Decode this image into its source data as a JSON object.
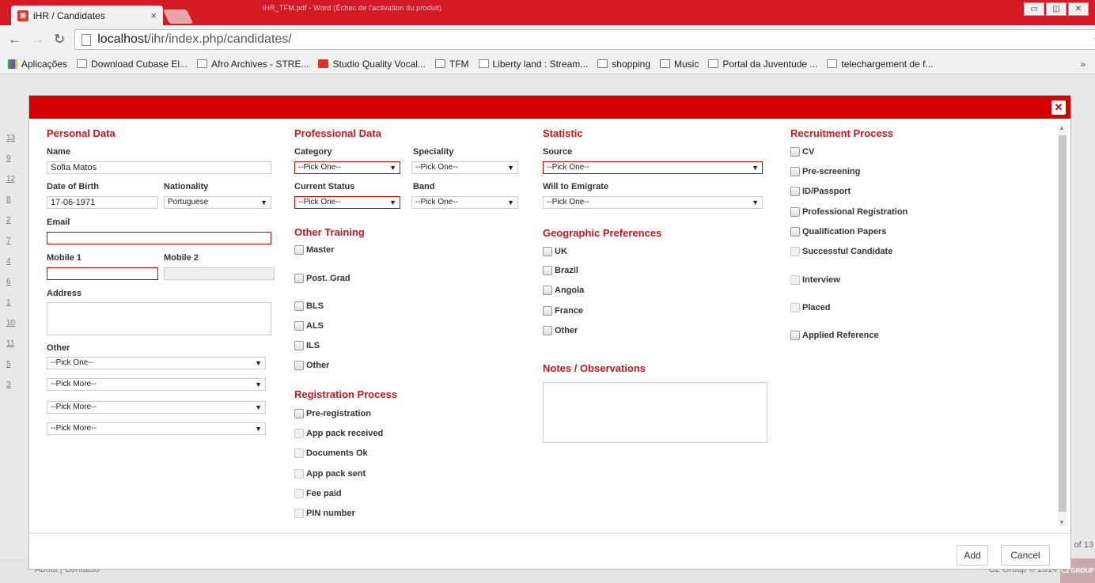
{
  "browser": {
    "tab_title": "iHR / Candidates",
    "window_title": "iHR_TFM.pdf - Word (Échec de l'activation du produit)",
    "url_host": "localhost",
    "url_path": "/ihr/index.php/candidates/"
  },
  "bookmarks": [
    "Aplicações",
    "Download Cubase El...",
    "Afro Archives - STRE...",
    "Studio Quality Vocal...",
    "TFM",
    "Liberty land : Stream...",
    "shopping",
    "Music",
    "Portal da Juventude ...",
    "telechargement de f..."
  ],
  "background": {
    "id_links": [
      "13",
      "9",
      "12",
      "8",
      "2",
      "7",
      "4",
      "6",
      "1",
      "10",
      "11",
      "5",
      "3"
    ],
    "pagination": "of 13",
    "footer_left": "About | Contacto",
    "footer_right": "C2 Group © 2014",
    "logo": "C2 GROUP"
  },
  "personal": {
    "title": "Personal Data",
    "name_label": "Name",
    "name_value": "Sofia Matos",
    "dob_label": "Date of Birth",
    "dob_value": "17-06-1971",
    "nat_label": "Nationality",
    "nat_value": "Portuguese",
    "email_label": "Email",
    "mobile1_label": "Mobile 1",
    "mobile2_label": "Mobile 2",
    "address_label": "Address",
    "other_label": "Other",
    "other_selects": [
      "--Pick One--",
      "--Pick More--",
      "--Pick More--",
      "--Pick More--"
    ]
  },
  "professional": {
    "title": "Professional Data",
    "category_label": "Category",
    "category_value": "--Pick One--",
    "speciality_label": "Speciality",
    "speciality_value": "--Pick One--",
    "status_label": "Current Status",
    "status_value": "--Pick One--",
    "band_label": "Band",
    "band_value": "--Pick One--"
  },
  "training": {
    "title": "Other Training",
    "items": [
      "Master",
      "Post. Grad",
      "BLS",
      "ALS",
      "ILS",
      "Other"
    ]
  },
  "registration": {
    "title": "Registration Process",
    "items": [
      "Pre-registration",
      "App pack received",
      "Documents Ok",
      "App pack sent",
      "Fee paid",
      "PIN number"
    ]
  },
  "statistic": {
    "title": "Statistic",
    "source_label": "Source",
    "source_value": "--Pick One--",
    "emigrate_label": "Will to Emigrate",
    "emigrate_value": "--Pick One--"
  },
  "geo": {
    "title": "Geographic Preferences",
    "items": [
      "UK",
      "Brazil",
      "Angola",
      "France",
      "Other"
    ]
  },
  "notes": {
    "title": "Notes / Observations"
  },
  "recruitment": {
    "title": "Recruitment Process",
    "items": [
      "CV",
      "Pre-screening",
      "ID/Passport",
      "Professional Registration",
      "Qualification Papers",
      "Successful Candidate",
      "Interview",
      "Placed",
      "Applied Reference"
    ]
  },
  "footer": {
    "add": "Add",
    "cancel": "Cancel"
  },
  "colors": {
    "accent": "#d40000",
    "heading": "#c8161e"
  }
}
